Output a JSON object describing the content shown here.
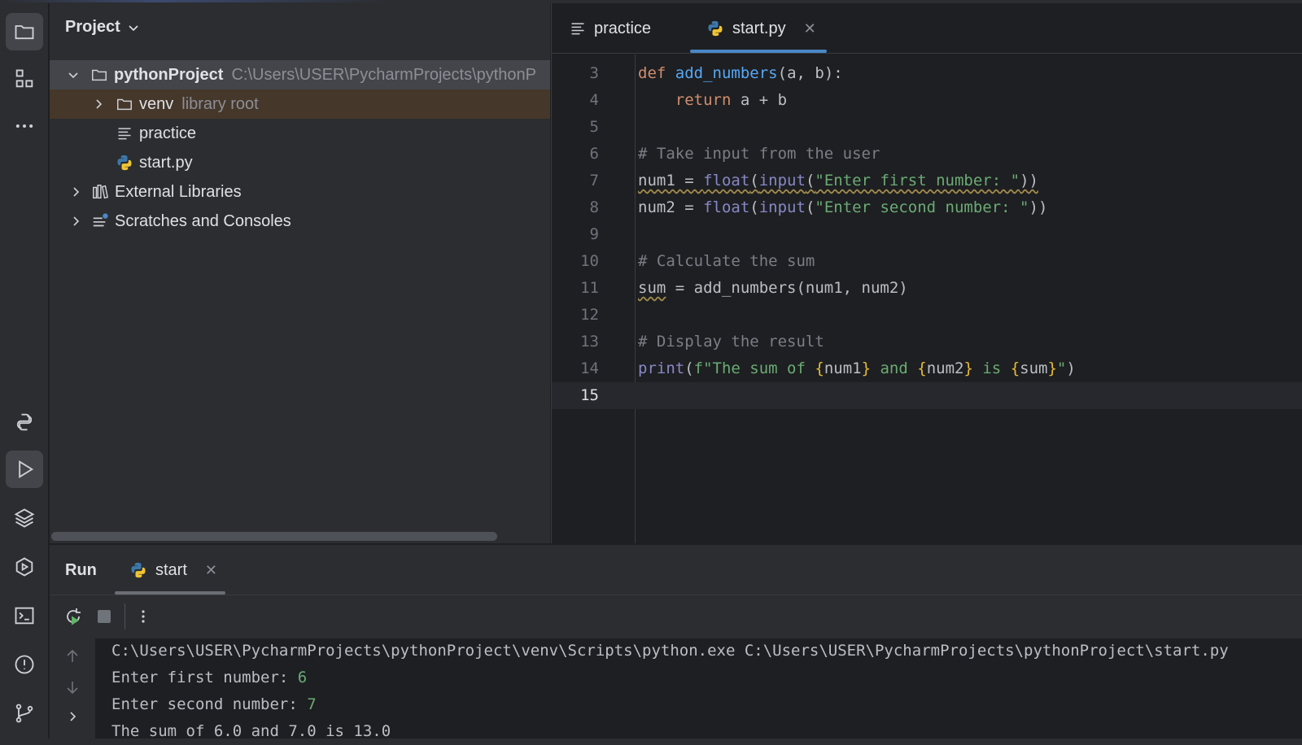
{
  "project_panel": {
    "title": "Project",
    "tree": [
      {
        "label": "pythonProject",
        "detail": "C:\\Users\\USER\\PycharmProjects\\pythonP",
        "icon": "folder-icon",
        "expanded": true
      },
      {
        "label": "venv",
        "detail": "library root",
        "icon": "folder-icon",
        "expanded": false
      },
      {
        "label": "practice",
        "icon": "text-file-icon"
      },
      {
        "label": "start.py",
        "icon": "python-file-icon"
      },
      {
        "label": "External Libraries",
        "icon": "library-icon",
        "expanded": false
      },
      {
        "label": "Scratches and Consoles",
        "icon": "scratches-icon",
        "expanded": false
      }
    ]
  },
  "editor": {
    "tabs": [
      {
        "label": "practice",
        "icon": "text-file-icon",
        "active": false
      },
      {
        "label": "start.py",
        "icon": "python-file-icon",
        "active": true
      }
    ],
    "line_numbers": [
      "3",
      "4",
      "5",
      "6",
      "7",
      "8",
      "9",
      "10",
      "11",
      "12",
      "13",
      "14",
      "15"
    ],
    "current_line": "15",
    "code_lines": [
      "def add_numbers(a, b):",
      "    return a + b",
      "",
      "# Take input from the user",
      "num1 = float(input(\"Enter first number: \"))",
      "num2 = float(input(\"Enter second number: \"))",
      "",
      "# Calculate the sum",
      "sum = add_numbers(num1, num2)",
      "",
      "# Display the result",
      "print(f\"The sum of {num1} and {num2} is {sum}\")",
      ""
    ]
  },
  "run_panel": {
    "title": "Run",
    "tab_label": "start",
    "output": {
      "command": "C:\\Users\\USER\\PycharmProjects\\pythonProject\\venv\\Scripts\\python.exe C:\\Users\\USER\\PycharmProjects\\pythonProject\\start.py",
      "prompt1": "Enter first number: ",
      "input1": "6",
      "prompt2": "Enter second number: ",
      "input2": "7",
      "result": "The sum of 6.0 and 7.0 is 13.0"
    }
  },
  "colors": {
    "background": "#1e1f22",
    "panel": "#2b2d30",
    "keyword": "#cf8e6d",
    "function": "#56a8f5",
    "string": "#6aab73",
    "comment": "#7a7e85",
    "accent": "#4a88c7"
  }
}
